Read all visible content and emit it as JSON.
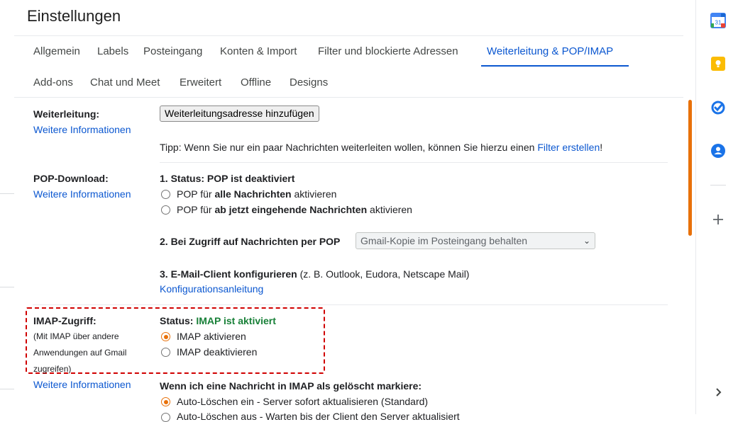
{
  "header": {
    "title": "Einstellungen"
  },
  "tabs": [
    {
      "label": "Allgemein"
    },
    {
      "label": "Labels"
    },
    {
      "label": "Posteingang"
    },
    {
      "label": "Konten & Import"
    },
    {
      "label": "Filter und blockierte Adressen"
    },
    {
      "label": "Weiterleitung & POP/IMAP",
      "active": true
    },
    {
      "label": "Add-ons"
    },
    {
      "label": "Chat und Meet"
    },
    {
      "label": "Erweitert"
    },
    {
      "label": "Offline"
    },
    {
      "label": "Designs"
    }
  ],
  "forwarding": {
    "label": "Weiterleitung:",
    "more_info": "Weitere Informationen",
    "add_button": "Weiterleitungsadresse hinzufügen",
    "tip_text": "Tipp: Wenn Sie nur ein paar Nachrichten weiterleiten wollen, können Sie hierzu einen ",
    "tip_link": "Filter erstellen",
    "tip_end": "!"
  },
  "pop": {
    "label": "POP-Download:",
    "more_info": "Weitere Informationen",
    "status": "1. Status: POP ist deaktiviert",
    "opt1_pre": "POP für ",
    "opt1_bold": "alle Nachrichten",
    "opt1_post": " aktivieren",
    "opt2_pre": "POP für ",
    "opt2_bold": "ab jetzt eingehende Nachrichten",
    "opt2_post": " aktivieren",
    "access_label": "2. Bei Zugriff auf Nachrichten per POP",
    "access_select": "Gmail-Kopie im Posteingang behalten",
    "client_label": "3. E-Mail-Client konfigurieren",
    "client_examples": " (z. B. Outlook, Eudora, Netscape Mail)",
    "config_link": "Konfigurationsanleitung"
  },
  "imap": {
    "label": "IMAP-Zugriff:",
    "description": "(Mit IMAP über andere Anwendungen auf Gmail zugreifen)",
    "more_info": "Weitere Informationen",
    "status_label": "Status: ",
    "status_value": "IMAP ist aktiviert",
    "enable": "IMAP aktivieren",
    "disable": "IMAP deaktivieren",
    "delete_heading": "Wenn ich eine Nachricht in IMAP als gelöscht markiere:",
    "auto_expunge_on": "Auto-Löschen ein - Server sofort aktualisieren (Standard)",
    "auto_expunge_off": "Auto-Löschen aus - Warten bis der Client den Server aktualisiert"
  },
  "right_rail": {
    "calendar_day": "31",
    "icons": [
      "calendar-icon",
      "keep-icon",
      "tasks-icon",
      "contacts-icon",
      "add-icon",
      "expand-icon"
    ]
  },
  "colors": {
    "accent": "#0b57d0",
    "radio_checked": "#e8710a",
    "status_green": "#188038",
    "highlight_border": "#d00000"
  }
}
